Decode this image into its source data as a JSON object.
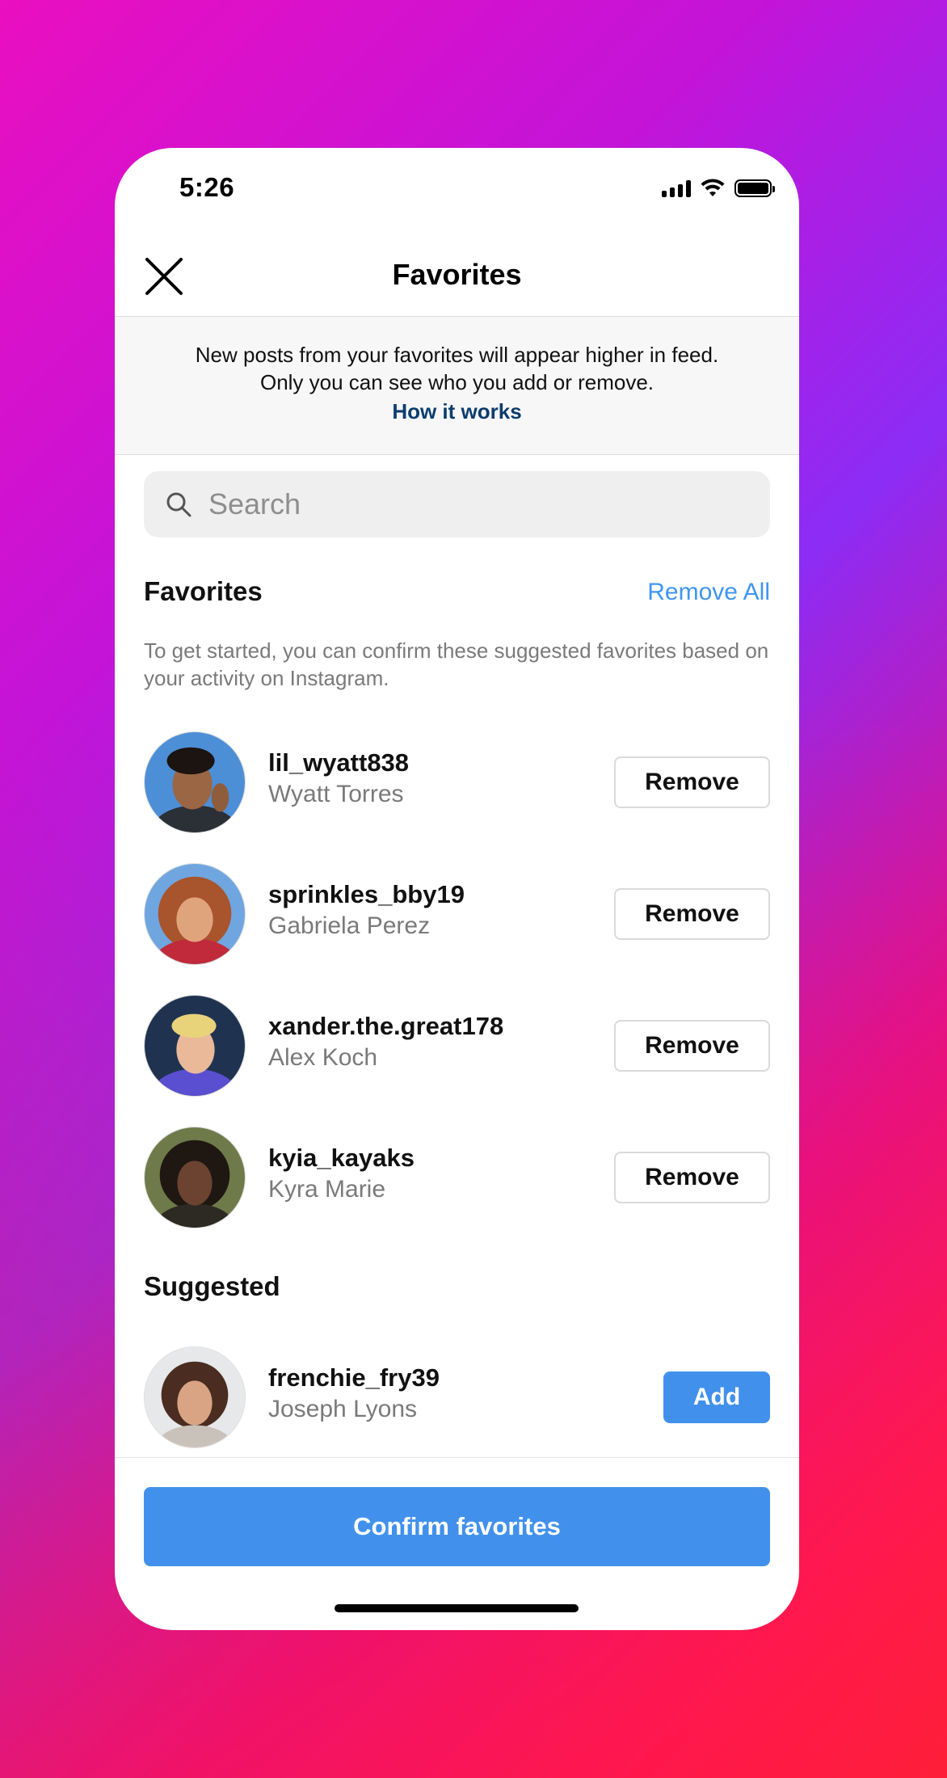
{
  "status_bar": {
    "time": "5:26",
    "icons": [
      "signal-icon",
      "wifi-icon",
      "battery-icon"
    ]
  },
  "header": {
    "title": "Favorites",
    "close_icon": "close-icon"
  },
  "info": {
    "line1": "New posts from your favorites will appear higher in feed.",
    "line2": "Only you can see who you add or remove.",
    "link": "How it works"
  },
  "search": {
    "placeholder": "Search",
    "icon": "search-icon"
  },
  "favorites": {
    "title": "Favorites",
    "remove_all": "Remove All",
    "description": "To get started, you can confirm these suggested favorites based on your activity on Instagram.",
    "users": [
      {
        "username": "lil_wyatt838",
        "name": "Wyatt Torres",
        "action": "Remove"
      },
      {
        "username": "sprinkles_bby19",
        "name": "Gabriela Perez",
        "action": "Remove"
      },
      {
        "username": "xander.the.great178",
        "name": "Alex Koch",
        "action": "Remove"
      },
      {
        "username": "kyia_kayaks",
        "name": "Kyra Marie",
        "action": "Remove"
      }
    ]
  },
  "suggested": {
    "title": "Suggested",
    "users": [
      {
        "username": "frenchie_fry39",
        "name": "Joseph Lyons",
        "action": "Add"
      }
    ]
  },
  "confirm_button": "Confirm favorites",
  "colors": {
    "accent_blue": "#4191ec",
    "link_blue": "#3f95f0",
    "link_dark_blue": "#0b3d6e",
    "gradient_magenta": "#ea0fc0",
    "gradient_purple": "#8c2cf5",
    "gradient_red": "#ff2a2a"
  }
}
